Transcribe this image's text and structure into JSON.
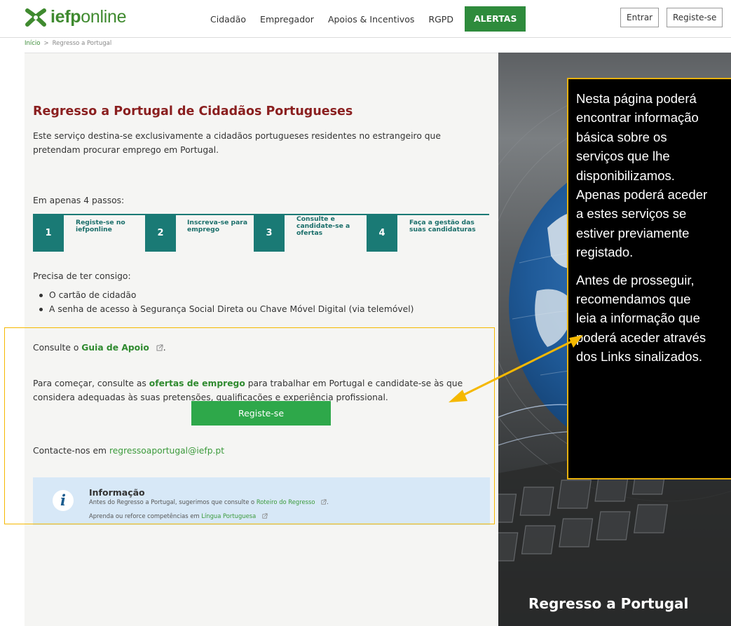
{
  "header": {
    "logo": {
      "bold": "iefp",
      "light": "online"
    },
    "nav": [
      "Cidadão",
      "Empregador",
      "Apoios & Incentivos",
      "RGPD"
    ],
    "alert_label": "ALERTAS",
    "login_label": "Entrar",
    "register_label": "Registe-se"
  },
  "breadcrumb": {
    "home": "Início",
    "separator": ">",
    "current": "Regresso a Portugal"
  },
  "main": {
    "title": "Regresso a Portugal de Cidadãos Portugueses",
    "intro": "Este serviço destina-se exclusivamente a cidadãos portugueses residentes no estrangeiro que pretendam procurar emprego em Portugal.",
    "steps_label": "Em apenas 4 passos:",
    "steps": [
      {
        "number": "1",
        "label": "Registe-se no iefponline"
      },
      {
        "number": "2",
        "label": "Inscreva-se para emprego"
      },
      {
        "number": "3",
        "label": "Consulte e candidate-se a ofertas"
      },
      {
        "number": "4",
        "label": "Faça a gestão das suas candidaturas"
      }
    ],
    "needs_label": "Precisa de ter consigo:",
    "needs": [
      "O cartão de cidadão",
      "A senha de acesso à Segurança Social Direta ou Chave Móvel Digital (via telemóvel)"
    ],
    "consult_prefix": "Consulte o",
    "guide_link": "Guia de Apoio",
    "consult_suffix": ".",
    "para_prefix": "Para começar, consulte as",
    "offers_link": "ofertas de emprego",
    "para_suffix": "para trabalhar em Portugal e candidate-se às que considera adequadas às suas pretensões, qualificações e experiência profissional.",
    "register_button": "Registe-se",
    "contact_prefix": "Contacte-nos em",
    "contact_email": "regressoaportugal@iefp.pt",
    "info": {
      "title": "Informação",
      "line1_prefix": "Antes do Regresso a Portugal, sugerimos que consulte o",
      "line1_link": "Roteiro do Regresso",
      "line1_suffix": ".",
      "line2_prefix": "Aprenda ou reforce competências em",
      "line2_link": "Língua Portuguesa"
    }
  },
  "hero": {
    "title": "Regresso a Portugal"
  },
  "callout": {
    "paragraph1": "Nesta página poderá\nencontrar informação\nbásica sobre os\nserviços que lhe\ndisponibilizamos.\nApenas poderá aceder\na estes serviços se\nestiver previamente\nregistado.",
    "paragraph2": "Antes de prosseguir,\nrecomendamos que\nleia a informação que\npoderá aceder através\ndos Links sinalizados."
  },
  "colors": {
    "brand_green": "#2e8b3c",
    "title_red": "#8a1f1f",
    "step_teal": "#1a7a75",
    "button_green": "#2ea84a",
    "annotation_yellow": "#f5b800",
    "info_blue": "#d7e8f7"
  },
  "icons": [
    "iefp-logo-icon",
    "external-link-icon",
    "info-icon",
    "annotation-arrow-icon"
  ]
}
